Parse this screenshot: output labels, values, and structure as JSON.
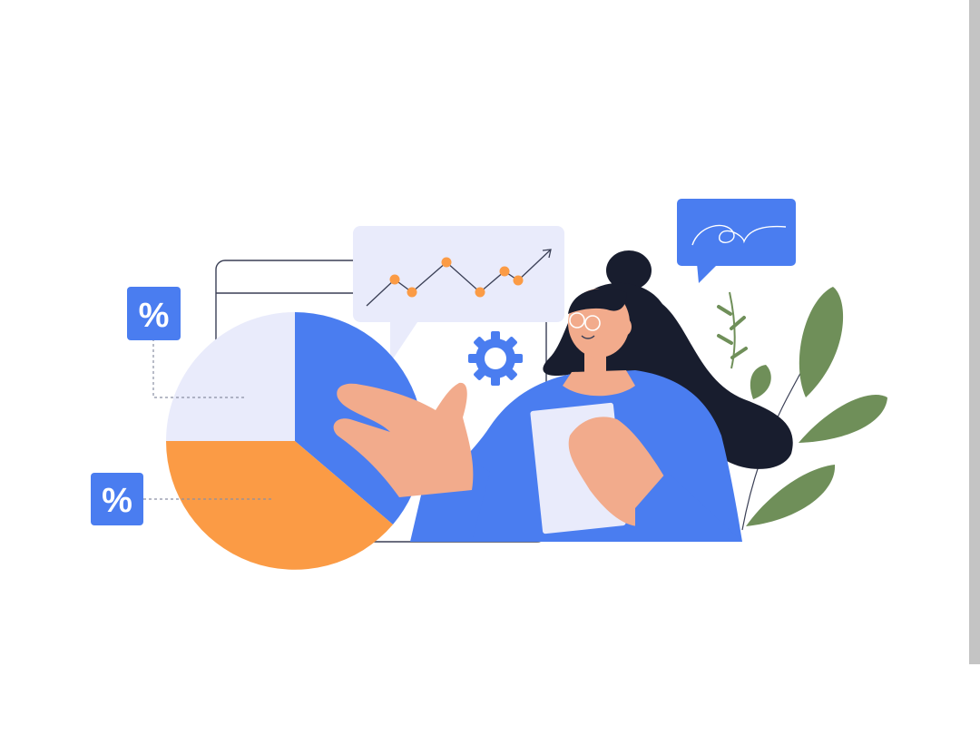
{
  "illustration": {
    "badges": [
      {
        "label": "%"
      },
      {
        "label": "%"
      }
    ]
  },
  "colors": {
    "blue": "#4a7df0",
    "orange": "#fb9b45",
    "lavender": "#e9ebfb",
    "leaf": "#6f8f59",
    "hair": "#181d2e",
    "skin": "#f2ab8c"
  }
}
